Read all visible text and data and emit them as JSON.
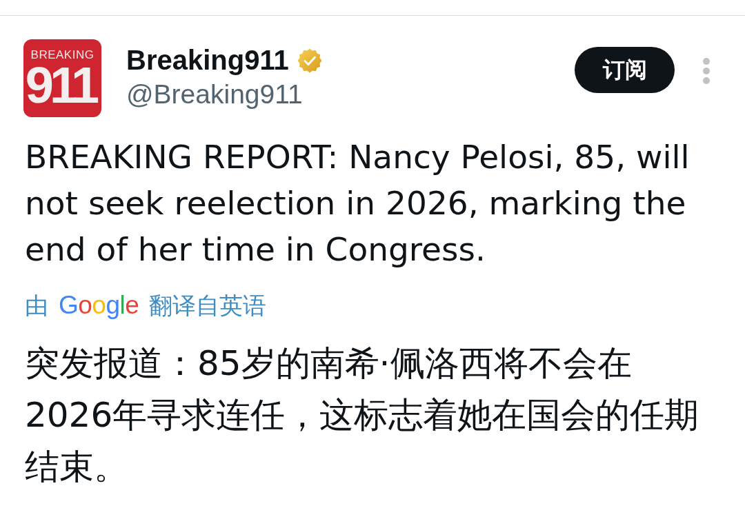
{
  "author": {
    "avatar": {
      "top_text": "BREAKING",
      "main_text": "911"
    },
    "name": "Breaking911",
    "verified": true,
    "handle": "@Breaking911"
  },
  "subscribe_button": {
    "label": "订阅"
  },
  "post": {
    "text": "BREAKING REPORT: Nancy Pelosi, 85, will not seek reelection in 2026, marking the end of her time in Congress.",
    "translation_note": {
      "prefix": "由",
      "provider": "Google",
      "suffix": "翻译自英语"
    },
    "translated_text": "突发报道：85岁的南希·佩洛西将不会在2026年寻求连任，这标志着她在国会的任期结束。"
  }
}
